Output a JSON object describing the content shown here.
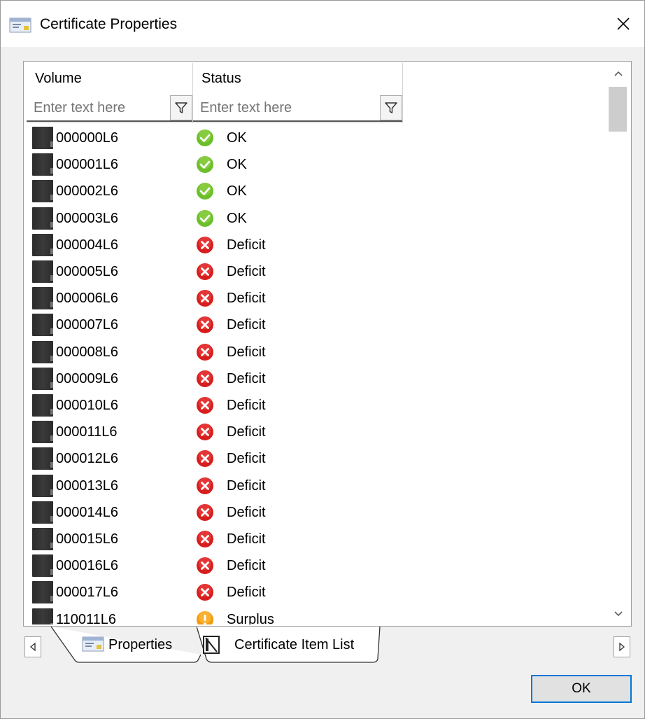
{
  "window": {
    "title": "Certificate Properties",
    "title_icon": "properties-sheet-icon",
    "close_icon": "close-icon"
  },
  "grid": {
    "columns": [
      {
        "label": "Volume",
        "filter_placeholder": "Enter text here",
        "filter_icon": "filter-funnel-icon"
      },
      {
        "label": "Status",
        "filter_placeholder": "Enter text here",
        "filter_icon": "filter-funnel-icon"
      }
    ],
    "rows": [
      {
        "volume": "000000L6",
        "status": "OK",
        "status_icon": "ok-check-icon"
      },
      {
        "volume": "000001L6",
        "status": "OK",
        "status_icon": "ok-check-icon"
      },
      {
        "volume": "000002L6",
        "status": "OK",
        "status_icon": "ok-check-icon"
      },
      {
        "volume": "000003L6",
        "status": "OK",
        "status_icon": "ok-check-icon"
      },
      {
        "volume": "000004L6",
        "status": "Deficit",
        "status_icon": "error-x-icon"
      },
      {
        "volume": "000005L6",
        "status": "Deficit",
        "status_icon": "error-x-icon"
      },
      {
        "volume": "000006L6",
        "status": "Deficit",
        "status_icon": "error-x-icon"
      },
      {
        "volume": "000007L6",
        "status": "Deficit",
        "status_icon": "error-x-icon"
      },
      {
        "volume": "000008L6",
        "status": "Deficit",
        "status_icon": "error-x-icon"
      },
      {
        "volume": "000009L6",
        "status": "Deficit",
        "status_icon": "error-x-icon"
      },
      {
        "volume": "000010L6",
        "status": "Deficit",
        "status_icon": "error-x-icon"
      },
      {
        "volume": "000011L6",
        "status": "Deficit",
        "status_icon": "error-x-icon"
      },
      {
        "volume": "000012L6",
        "status": "Deficit",
        "status_icon": "error-x-icon"
      },
      {
        "volume": "000013L6",
        "status": "Deficit",
        "status_icon": "error-x-icon"
      },
      {
        "volume": "000014L6",
        "status": "Deficit",
        "status_icon": "error-x-icon"
      },
      {
        "volume": "000015L6",
        "status": "Deficit",
        "status_icon": "error-x-icon"
      },
      {
        "volume": "000016L6",
        "status": "Deficit",
        "status_icon": "error-x-icon"
      },
      {
        "volume": "000017L6",
        "status": "Deficit",
        "status_icon": "error-x-icon"
      },
      {
        "volume": "110011L6",
        "status": "Surplus",
        "status_icon": "warning-exclamation-icon"
      }
    ]
  },
  "tabs": [
    {
      "label": "Properties",
      "icon": "properties-sheet-icon",
      "selected": false
    },
    {
      "label": "Certificate Item List",
      "icon": "tape-cartridge-icon",
      "selected": true
    }
  ],
  "buttons": {
    "ok_label": "OK"
  },
  "colors": {
    "accent": "#0078d7",
    "ok": "#6cbf2a",
    "deficit": "#e02424",
    "surplus": "#f29a0a"
  }
}
